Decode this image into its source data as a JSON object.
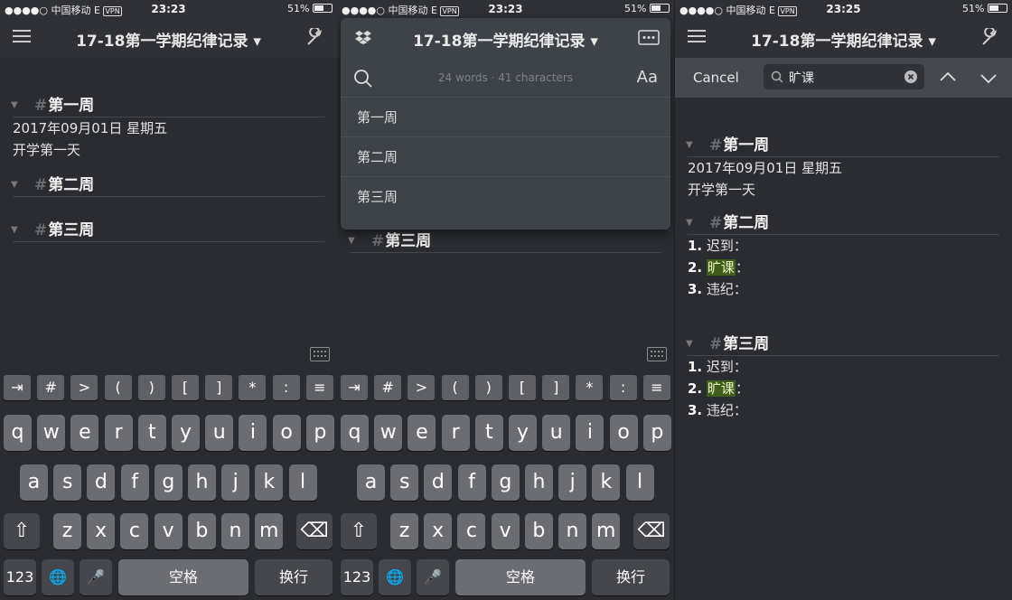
{
  "status": {
    "carrier": "●●●●○ 中国移动",
    "net": "E",
    "vpn": "VPN",
    "battery": "51%",
    "time1": "23:23",
    "time2": "23:23",
    "time3": "23:25"
  },
  "doc_title": "17-18第一学期纪律记录 ▾",
  "editor": {
    "h1": "第一周",
    "h2": "第二周",
    "h3": "第三周",
    "date": "2017年09月01日 星期五",
    "note": "开学第一天",
    "hash": "#",
    "items": [
      "迟到：",
      "旷课",
      "违纪："
    ],
    "nums": [
      "1.",
      "2.",
      "3."
    ],
    "colon": "："
  },
  "dropdown": {
    "words": "24 words",
    "dot": "·",
    "chars": "41 characters",
    "aa": "Aa",
    "toc": [
      "第一周",
      "第二周",
      "第三周"
    ]
  },
  "search": {
    "cancel": "Cancel",
    "query": "旷课"
  },
  "keyboard": {
    "toolbar": [
      "⇥",
      "#",
      ">",
      "(",
      ")",
      "[",
      "]",
      "*",
      ":",
      "≡"
    ],
    "row1": [
      "q",
      "w",
      "e",
      "r",
      "t",
      "y",
      "u",
      "i",
      "o",
      "p"
    ],
    "row2": [
      "a",
      "s",
      "d",
      "f",
      "g",
      "h",
      "j",
      "k",
      "l"
    ],
    "row3": [
      "z",
      "x",
      "c",
      "v",
      "b",
      "n",
      "m"
    ],
    "num": "123",
    "space": "空格",
    "return": "换行"
  },
  "colors": {
    "highlight": "#3f5e1a",
    "bg": "#2a2c31",
    "bar": "#2f3136"
  }
}
